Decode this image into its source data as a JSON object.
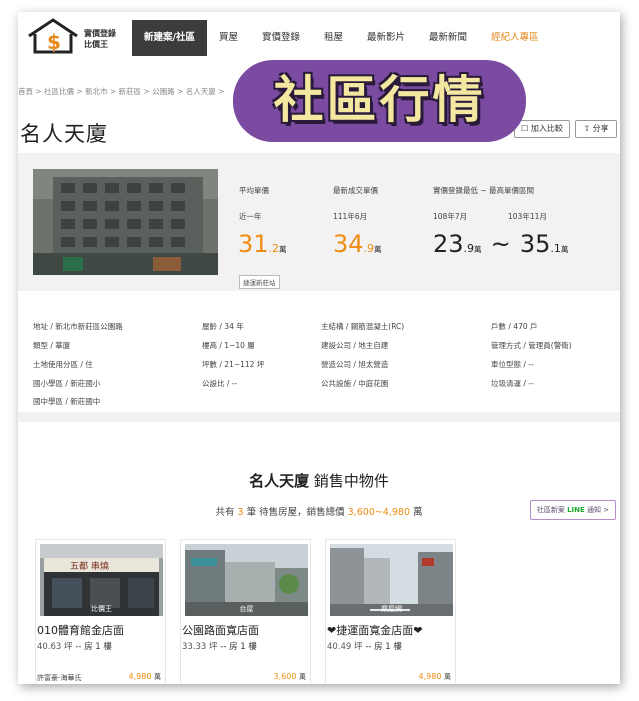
{
  "header": {
    "logo_line1": "實價登錄",
    "logo_line2": "比價王",
    "nav": [
      {
        "label": "新建案/社區"
      },
      {
        "label": "買屋"
      },
      {
        "label": "實價登錄"
      },
      {
        "label": "租屋"
      },
      {
        "label": "最新影片"
      },
      {
        "label": "最新新聞"
      },
      {
        "label": "經紀人專區"
      }
    ]
  },
  "breadcrumb": "首頁 > 社區比價 > 新北市 > 新莊區 > 公園路 > 名人天廈 >",
  "banner": "社區行情",
  "page_title": "名人天廈",
  "buttons": {
    "compare": "加入比較",
    "share": "分享"
  },
  "prices": {
    "avg_label": "平均單價",
    "avg_period": "近一年",
    "avg_int": "31",
    "avg_dec": ".2",
    "latest_label": "最新成交單價",
    "latest_date": "111年6月",
    "latest_int": "34",
    "latest_dec": ".9",
    "range_label": "實價登錄最低 ~ 最高單價區間",
    "low_date": "108年7月",
    "high_date": "103年11月",
    "low_int": "23",
    "low_dec": ".9",
    "high_int": "35",
    "high_dec": ".1",
    "unit": "萬",
    "tilde": "~",
    "station_tag": "捷運新莊站"
  },
  "details": {
    "address": "地址 / 新北市新莊區公園路",
    "type": "類型 / 華廈",
    "zoning": "土地使用分區 / 住",
    "elementary": "國小學區 / 新莊國小",
    "middle": "國中學區 / 新莊國中",
    "age": "屋齡 / 34 年",
    "floors": "樓高 / 1~10 層",
    "area": "坪數 / 21~112 坪",
    "public_ratio": "公設比 / --",
    "structure": "主結構 / 鋼筋混凝土(RC)",
    "builder": "建設公司 / 地主自建",
    "contractor": "營造公司 / 旭太營造",
    "facilities": "公共設施 / 中庭花園",
    "households": "戶數 / 470 戶",
    "management": "管理方式 / 管理員(警衛)",
    "parking": "車位型態 / --",
    "garbage": "垃圾清運 / --"
  },
  "sale": {
    "title_name": "名人天廈",
    "title_rest": "銷售中物件",
    "summary_prefix": "共有",
    "count": "3",
    "summary_mid": "筆 待售房屋，銷售總價",
    "range": "3,600~4,980",
    "summary_suffix": "萬",
    "line_prefix": "社區新案",
    "line_word": "LINE",
    "line_suffix": "通知 >"
  },
  "listings": [
    {
      "watermark": "比價王",
      "name": "010體育館金店面",
      "size": "40.63 坪",
      "rooms": "-- 房 1 樓",
      "agent": "許富豪-海華氏",
      "price": "4,980",
      "unit": "萬"
    },
    {
      "watermark": "台屋",
      "name": "公園路面寬店面",
      "size": "33.33 坪",
      "rooms": "-- 房 1 樓",
      "agent": "",
      "price": "3,600",
      "unit": "萬"
    },
    {
      "watermark": "樂屋網",
      "name": "❤捷運面寬金店面❤",
      "size": "40.49 坪",
      "rooms": "-- 房 1 樓",
      "agent": "",
      "price": "4,980",
      "unit": "萬"
    }
  ],
  "colors": {
    "accent": "#f08c10",
    "nav_active": "#3c3c3c",
    "banner": "#7b4aa1",
    "banner_text": "#f4e8a0"
  }
}
